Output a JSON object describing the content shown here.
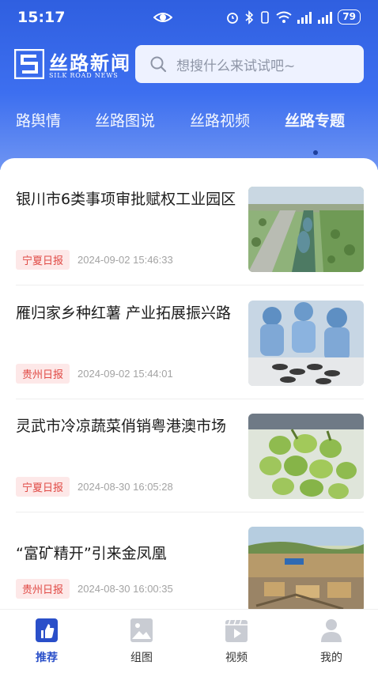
{
  "status_bar": {
    "time": "15:17",
    "battery": "79"
  },
  "app": {
    "name": "丝路新闻",
    "subtitle": "SILK ROAD NEWS"
  },
  "search": {
    "placeholder": "想搜什么来试试吧~"
  },
  "tabs": [
    {
      "label": "路舆情",
      "active": false
    },
    {
      "label": "丝路图说",
      "active": false
    },
    {
      "label": "丝路视频",
      "active": false
    },
    {
      "label": "丝路专题",
      "active": true
    }
  ],
  "articles": [
    {
      "title": "银川市6类事项审批赋权工业园区",
      "source": "宁夏日报",
      "date": "2024-09-02 15:46:33"
    },
    {
      "title": "雁归家乡种红薯 产业拓展振兴路",
      "source": "贵州日报",
      "date": "2024-09-02 15:44:01"
    },
    {
      "title": "灵武市冷凉蔬菜俏销粤港澳市场",
      "source": "宁夏日报",
      "date": "2024-08-30 16:05:28"
    },
    {
      "title": "“富矿精开”引来金凤凰",
      "source": "贵州日报",
      "date": "2024-08-30 16:00:35"
    }
  ],
  "bottom_nav": [
    {
      "label": "推荐",
      "icon": "thumbs-up-icon",
      "active": true
    },
    {
      "label": "组图",
      "icon": "image-icon",
      "active": false
    },
    {
      "label": "视频",
      "icon": "video-icon",
      "active": false
    },
    {
      "label": "我的",
      "icon": "user-icon",
      "active": false
    }
  ],
  "colors": {
    "primary": "#3d6ff0",
    "badge_text": "#e04a45",
    "badge_bg": "#fde8e8",
    "active_nav": "#2a4fc9"
  }
}
